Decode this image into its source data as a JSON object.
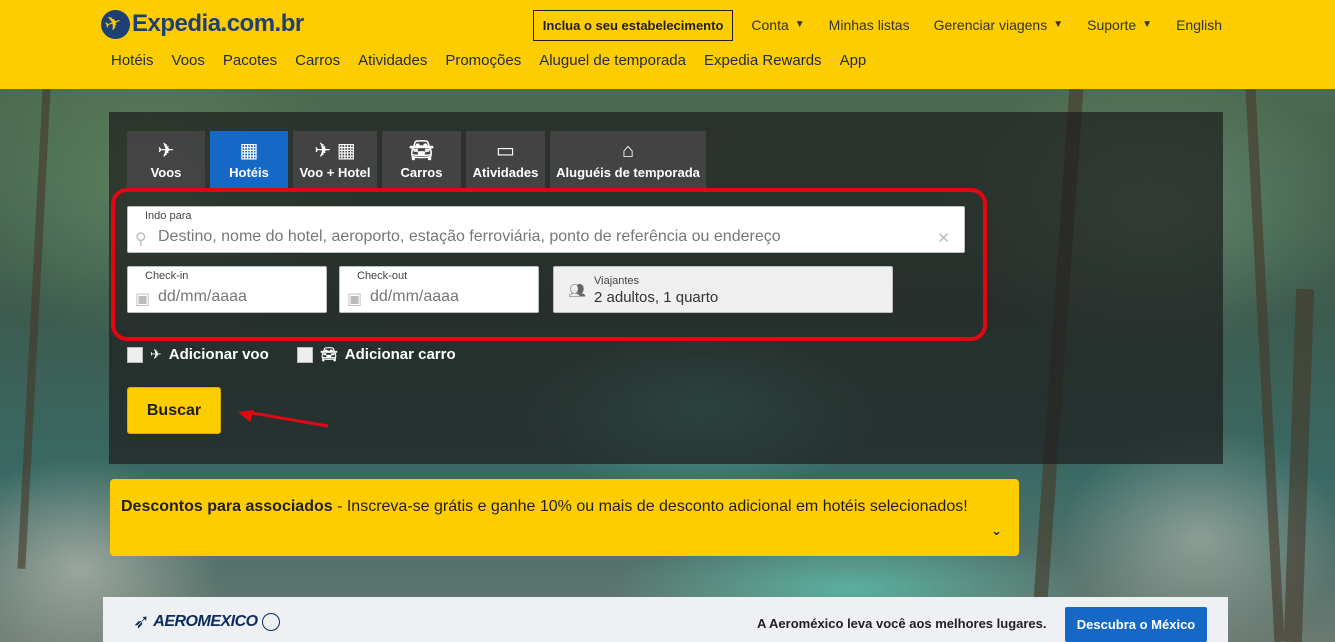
{
  "brand": {
    "name": "Expedia.com.br"
  },
  "header": {
    "list_property_label": "Inclua o seu estabelecimento",
    "top_links": [
      {
        "label": "Conta",
        "dropdown": true
      },
      {
        "label": "Minhas listas",
        "dropdown": false
      },
      {
        "label": "Gerenciar viagens",
        "dropdown": true
      },
      {
        "label": "Suporte",
        "dropdown": true
      },
      {
        "label": "English",
        "dropdown": false
      }
    ],
    "main_nav": [
      "Hotéis",
      "Voos",
      "Pacotes",
      "Carros",
      "Atividades",
      "Promoções",
      "Aluguel de temporada",
      "Expedia Rewards",
      "App"
    ]
  },
  "search": {
    "tabs": [
      {
        "label": "Voos",
        "icon": "airplane-icon",
        "active": false
      },
      {
        "label": "Hotéis",
        "icon": "building-icon",
        "active": true
      },
      {
        "label": "Voo + Hotel",
        "icon": "airplane-building-icon",
        "active": false
      },
      {
        "label": "Carros",
        "icon": "car-icon",
        "active": false
      },
      {
        "label": "Atividades",
        "icon": "ticket-icon",
        "active": false
      },
      {
        "label": "Aluguéis de temporada",
        "icon": "house-icon",
        "active": false
      }
    ],
    "destination": {
      "label": "Indo para",
      "placeholder": "Destino, nome do hotel, aeroporto, estação ferroviária, ponto de referência ou endereço"
    },
    "checkin": {
      "label": "Check-in",
      "placeholder": "dd/mm/aaaa"
    },
    "checkout": {
      "label": "Check-out",
      "placeholder": "dd/mm/aaaa"
    },
    "travelers": {
      "label": "Viajantes",
      "value": "2 adultos, 1 quarto"
    },
    "add_flight_label": "Adicionar voo",
    "add_car_label": "Adicionar carro",
    "submit_label": "Buscar"
  },
  "promo": {
    "title": "Descontos para associados",
    "text": " - Inscreva-se grátis e ganhe 10% ou mais de desconto adicional em hotéis selecionados!"
  },
  "ad": {
    "brand": "AEROMEXICO",
    "text": "A Aeroméxico leva você aos melhores lugares.",
    "button_label": "Descubra o México"
  },
  "colors": {
    "brand_yellow": "#fecd00",
    "brand_blue": "#1668c6",
    "highlight_red": "#e30613"
  }
}
